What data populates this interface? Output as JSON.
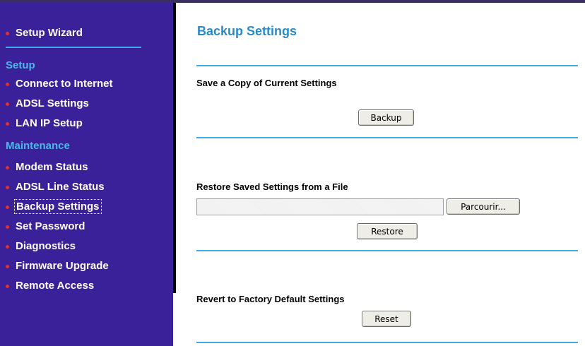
{
  "sidebar": {
    "wizard": "Setup Wizard",
    "setup_heading": "Setup",
    "setup_items": [
      "Connect to Internet",
      "ADSL Settings",
      "LAN IP Setup"
    ],
    "maintenance_heading": "Maintenance",
    "maintenance_items": [
      "Modem Status",
      "ADSL Line Status",
      "Backup Settings",
      "Set Password",
      "Diagnostics",
      "Firmware Upgrade",
      "Remote Access"
    ],
    "active_item": "Backup Settings"
  },
  "main": {
    "title": "Backup Settings",
    "save_section": {
      "heading": "Save a Copy of Current Settings",
      "button": "Backup"
    },
    "restore_section": {
      "heading": "Restore Saved Settings from a File",
      "file_value": "",
      "browse_button": "Parcourir...",
      "button": "Restore"
    },
    "reset_section": {
      "heading": "Revert to Factory Default Settings",
      "button": "Reset"
    }
  },
  "colors": {
    "sidebar_bg": "#3a2099",
    "heading_blue": "#4cb8e8",
    "title_blue": "#2a8ac8",
    "rule_blue": "#3fa9e8",
    "bullet_red": "#e0342a"
  }
}
